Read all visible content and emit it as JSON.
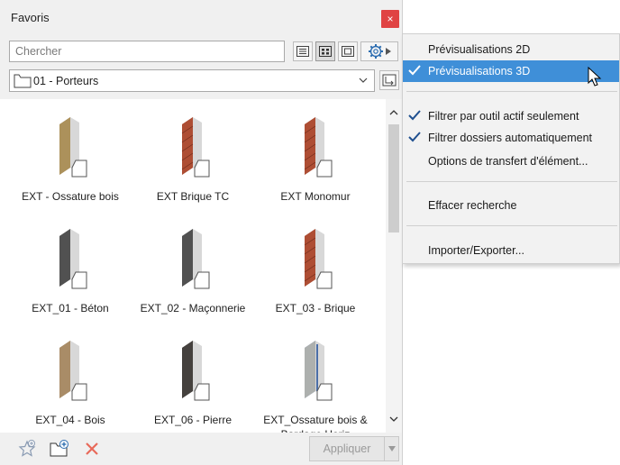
{
  "panel": {
    "title": "Favoris",
    "close_icon": "×",
    "search_placeholder": "Chercher",
    "folder": "01 - Porteurs",
    "view_buttons": [
      "list-view-icon",
      "grid-view-icon",
      "single-view-icon",
      "gear-icon"
    ]
  },
  "items": [
    {
      "label": "EXT - Ossature bois",
      "texture": "wood-frame"
    },
    {
      "label": "EXT Brique TC",
      "texture": "brick"
    },
    {
      "label": "EXT Monomur",
      "texture": "brick"
    },
    {
      "label": "EXT_01 - Béton",
      "texture": "concrete"
    },
    {
      "label": "EXT_02 - Maçonnerie",
      "texture": "concrete"
    },
    {
      "label": "EXT_03 - Brique",
      "texture": "brick"
    },
    {
      "label": "EXT_04 - Bois",
      "texture": "wood"
    },
    {
      "label": "EXT_06 - Pierre",
      "texture": "stone"
    },
    {
      "label": "EXT_Ossature bois & Bardage Horiz",
      "texture": "cladding"
    }
  ],
  "bottom": {
    "apply_label": "Appliquer"
  },
  "menu": {
    "items": [
      {
        "label": "Prévisualisations 2D",
        "checked": false,
        "highlighted": false
      },
      {
        "label": "Prévisualisations 3D",
        "checked": true,
        "highlighted": true
      },
      {
        "label": "Filtrer par outil actif seulement",
        "checked": true,
        "highlighted": false
      },
      {
        "label": "Filtrer dossiers automatiquement",
        "checked": true,
        "highlighted": false
      },
      {
        "label": "Options de transfert d'élément...",
        "checked": false,
        "highlighted": false
      },
      {
        "label": "Effacer recherche",
        "checked": false,
        "highlighted": false
      },
      {
        "label": "Importer/Exporter...",
        "checked": false,
        "highlighted": false
      }
    ]
  },
  "colors": {
    "accent": "#3f8fd8",
    "close": "#e04343",
    "brick": "#b4553a",
    "concrete": "#4a4a4a",
    "wood": "#a98a64"
  }
}
